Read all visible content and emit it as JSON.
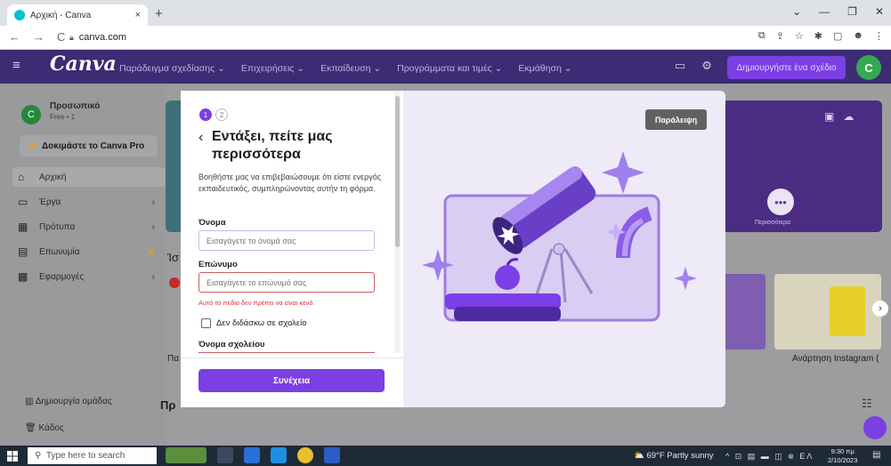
{
  "browser": {
    "tab_title": "Αρχική - Canva",
    "tab_close": "×",
    "new_tab": "+",
    "url": "canva.com",
    "nav": {
      "back": "←",
      "forward": "→",
      "reload": "C"
    }
  },
  "canva_header": {
    "logo": "Canva",
    "menu": [
      "Παράδειγμα σχεδίασης ⌄",
      "Επιχειρήσεις ⌄",
      "Εκπαίδευση ⌄",
      "Προγράμματα και τιμές ⌄",
      "Εκμάθηση ⌄"
    ],
    "create_button": "Δημιουργήστε ένα σχέδιο",
    "avatar_letter": "C"
  },
  "sidebar": {
    "avatar_letter": "C",
    "account_name": "Προσωπικό",
    "account_plan": "Free • 1",
    "try_pro": "Δοκιμάστε το Canva Pro",
    "items": [
      {
        "icon": "⌂",
        "label": "Αρχική",
        "chevron": ""
      },
      {
        "icon": "▭",
        "label": "Έργα",
        "chevron": "›"
      },
      {
        "icon": "▦",
        "label": "Πρότυπα",
        "chevron": "›"
      },
      {
        "icon": "▤",
        "label": "Επωνυμία",
        "chevron": "♛"
      },
      {
        "icon": "▩",
        "label": "Εφαρμογές",
        "chevron": "›"
      }
    ],
    "team": "Δημιουργία ομάδας",
    "trash": "Κάδος"
  },
  "main": {
    "more_label": "Περισσότερα",
    "recent_initial": "Ίσ",
    "instagram_caption": "Ανάρτηση Instagram (",
    "caption_left": "Πα",
    "section_title": "Πρ"
  },
  "modal": {
    "steps": [
      "1",
      "2"
    ],
    "title": "Εντάξει, πείτε μας περισσότερα",
    "description": "Βοηθήστε μας να επιβεβαιώσουμε ότι είστε ενεργός εκπαιδευτικός, συμπληρώνοντας αυτήν τη φόρμα.",
    "first_name_label": "Όνομα",
    "first_name_placeholder": "Εισαγάγετε το όνομά σας",
    "last_name_label": "Επώνυμο",
    "last_name_placeholder": "Εισαγάγετε το επώνυμό σας",
    "error": "Αυτό το πεδίο δεν πρέπει να είναι κενό.",
    "checkbox_label": "Δεν διδάσκω σε σχολείο",
    "school_label": "Όνομα σχολείου",
    "continue_button": "Συνέχεια",
    "skip_button": "Παράλειψη"
  },
  "taskbar": {
    "search_placeholder": "Type here to search",
    "weather": "69°F  Partly sunny",
    "tray": "^ ⊡ ▤ ▬ ◫ ᪤ ΕΛ",
    "time": "9:30 πμ",
    "date": "2/10/2023"
  },
  "colors": {
    "canva_header": "#3b2c74",
    "brand_purple": "#7b3fe4",
    "error_red": "#d13438",
    "illustration_bg": "#efeaf8"
  }
}
